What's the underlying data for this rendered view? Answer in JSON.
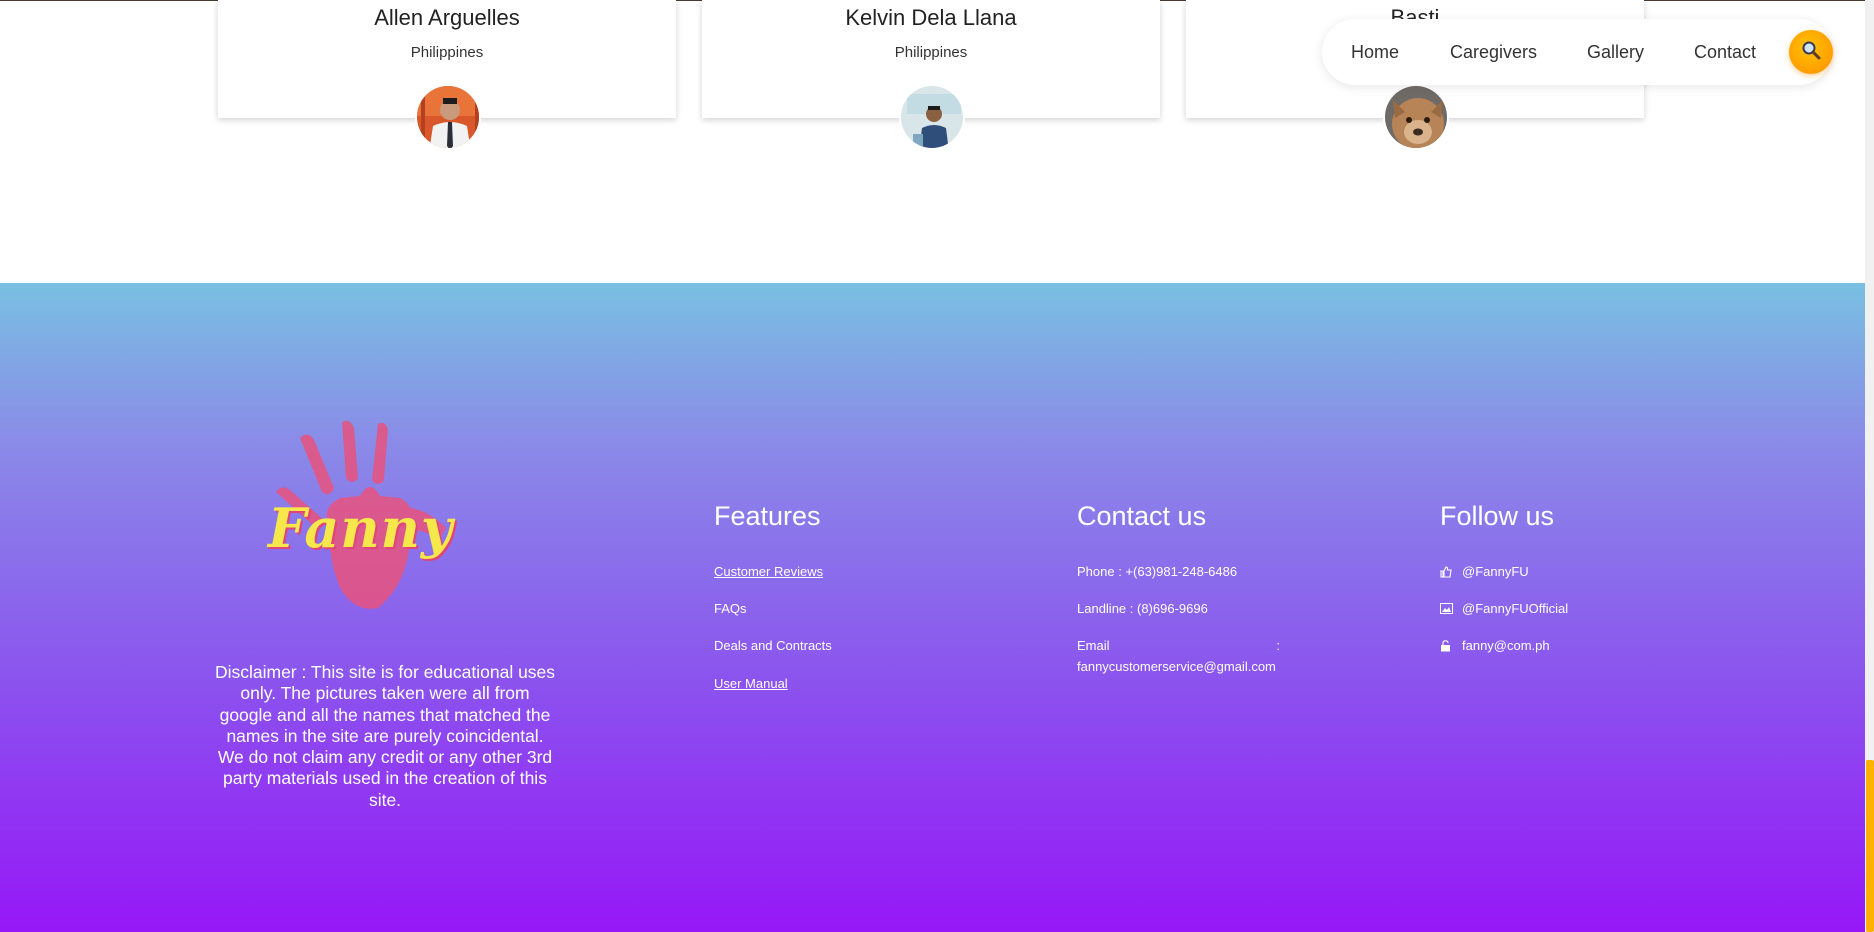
{
  "team": [
    {
      "name": "Allen Arguelles",
      "country": "Philippines"
    },
    {
      "name": "Kelvin Dela Llana",
      "country": "Philippines"
    },
    {
      "name": "Basti",
      "country": ""
    }
  ],
  "nav": {
    "items": [
      "Home",
      "Caregivers",
      "Gallery",
      "Contact"
    ],
    "search_icon": "search-icon"
  },
  "footer": {
    "logo_text": "Fanny",
    "disclaimer": "Disclaimer : This site is for educational uses only. The pictures taken were all from google and all the names that matched the names in the site are purely coincidental. We do not claim any credit or any other 3rd party materials used in the creation of this site.",
    "features": {
      "title": "Features",
      "items": [
        "Customer Reviews",
        "FAQs",
        "Deals and Contracts",
        "User Manual"
      ]
    },
    "contact": {
      "title": "Contact us",
      "phone": "Phone : +(63)981-248-6486",
      "landline": "Landline : (8)696-9696",
      "email_label": "Email",
      "email_sep": ":",
      "email_value": "fannycustomerservice@gmail.com"
    },
    "follow": {
      "title": "Follow us",
      "items": [
        {
          "icon": "thumbs-up-icon",
          "text": "@FannyFU"
        },
        {
          "icon": "image-icon",
          "text": "@FannyFUOfficial"
        },
        {
          "icon": "lock-icon",
          "text": "fanny@com.ph"
        }
      ]
    }
  },
  "colors": {
    "accent": "#ff9800",
    "footer_top": "#79c0e2",
    "footer_bottom": "#9617f7"
  }
}
